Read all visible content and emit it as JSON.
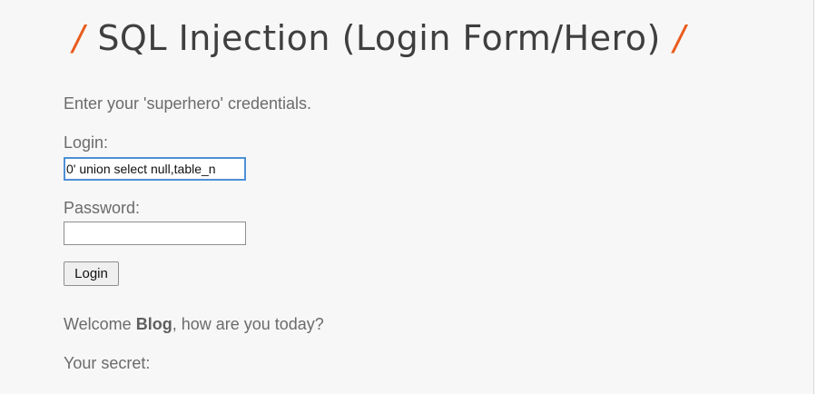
{
  "page": {
    "title": "SQL Injection (Login Form/Hero)",
    "title_decoration": "/",
    "intro": "Enter your 'superhero' credentials."
  },
  "form": {
    "login_label": "Login:",
    "login_value": "0' union select null,table_n",
    "password_label": "Password:",
    "password_value": "",
    "submit_label": "Login"
  },
  "result": {
    "welcome_prefix": "Welcome ",
    "welcome_name": "Blog",
    "welcome_suffix": ", how are you today?",
    "secret_label": "Your secret:"
  },
  "colors": {
    "accent": "#ea5b1c",
    "focus_border": "#4d90d6",
    "text": "#6b6b6b",
    "background": "#f7f7f7"
  }
}
